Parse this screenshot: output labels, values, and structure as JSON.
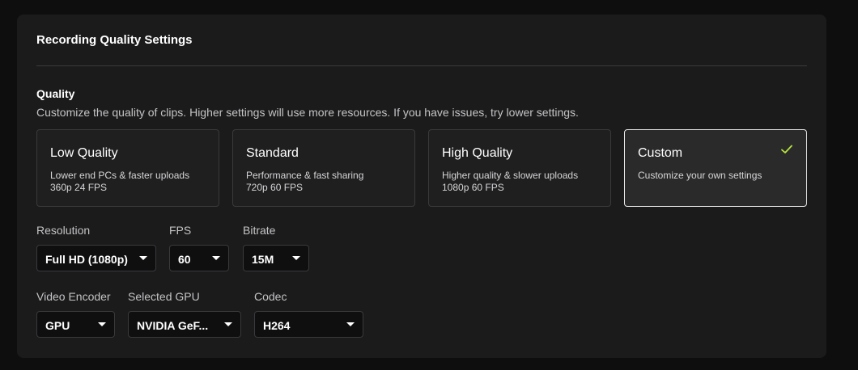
{
  "panel": {
    "title": "Recording Quality Settings"
  },
  "quality": {
    "title": "Quality",
    "description": "Customize the quality of clips. Higher settings will use more resources. If you have issues, try lower settings.",
    "selected": "Custom",
    "check_color": "#b6e33d",
    "presets": [
      {
        "title": "Low Quality",
        "line1": "Lower end PCs & faster uploads",
        "line2": "360p 24 FPS"
      },
      {
        "title": "Standard",
        "line1": "Performance & fast sharing",
        "line2": "720p 60 FPS"
      },
      {
        "title": "High Quality",
        "line1": "Higher quality & slower uploads",
        "line2": "1080p 60 FPS"
      },
      {
        "title": "Custom",
        "line1": "Customize your own settings",
        "line2": ""
      }
    ]
  },
  "settings": {
    "resolution": {
      "label": "Resolution",
      "value": "Full HD (1080p)"
    },
    "fps": {
      "label": "FPS",
      "value": "60"
    },
    "bitrate": {
      "label": "Bitrate",
      "value": "15M"
    },
    "encoder": {
      "label": "Video Encoder",
      "value": "GPU"
    },
    "gpu": {
      "label": "Selected GPU",
      "value": "NVIDIA GeF..."
    },
    "codec": {
      "label": "Codec",
      "value": "H264"
    }
  }
}
